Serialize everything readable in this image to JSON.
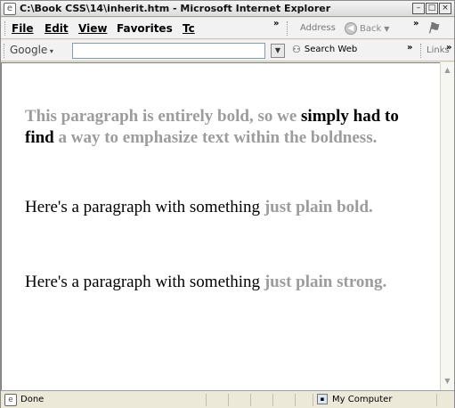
{
  "window": {
    "title": "C:\\Book CSS\\14\\inherit.htm - Microsoft Internet Explorer",
    "icon": "ie-page-icon",
    "controls": [
      "minimize",
      "maximize",
      "close"
    ]
  },
  "menubar": {
    "items": [
      {
        "label": "File"
      },
      {
        "label": "Edit"
      },
      {
        "label": "View"
      },
      {
        "label": "Favorites"
      },
      {
        "label": "Tc"
      }
    ],
    "overflow": "»",
    "address_label": "Address",
    "back_label": "Back",
    "overflow2": "»"
  },
  "google_toolbar": {
    "logo": "Google",
    "search_value": "",
    "search_web_label": "Search Web",
    "overflow": "»",
    "links_label": "Links"
  },
  "content": {
    "p1": {
      "a": "This paragraph is entirely bold, so we ",
      "b": "simply had to find",
      "c": " a way to emphasize text within the boldness."
    },
    "p2": {
      "a": "Here's a paragraph with something ",
      "b": "just plain bold."
    },
    "p3": {
      "a": "Here's a paragraph with something ",
      "b": "just plain strong."
    }
  },
  "statusbar": {
    "status": "Done",
    "zone": "My Computer"
  },
  "colors": {
    "gray_text": "#9c9c9c",
    "dark_text": "#000000"
  }
}
